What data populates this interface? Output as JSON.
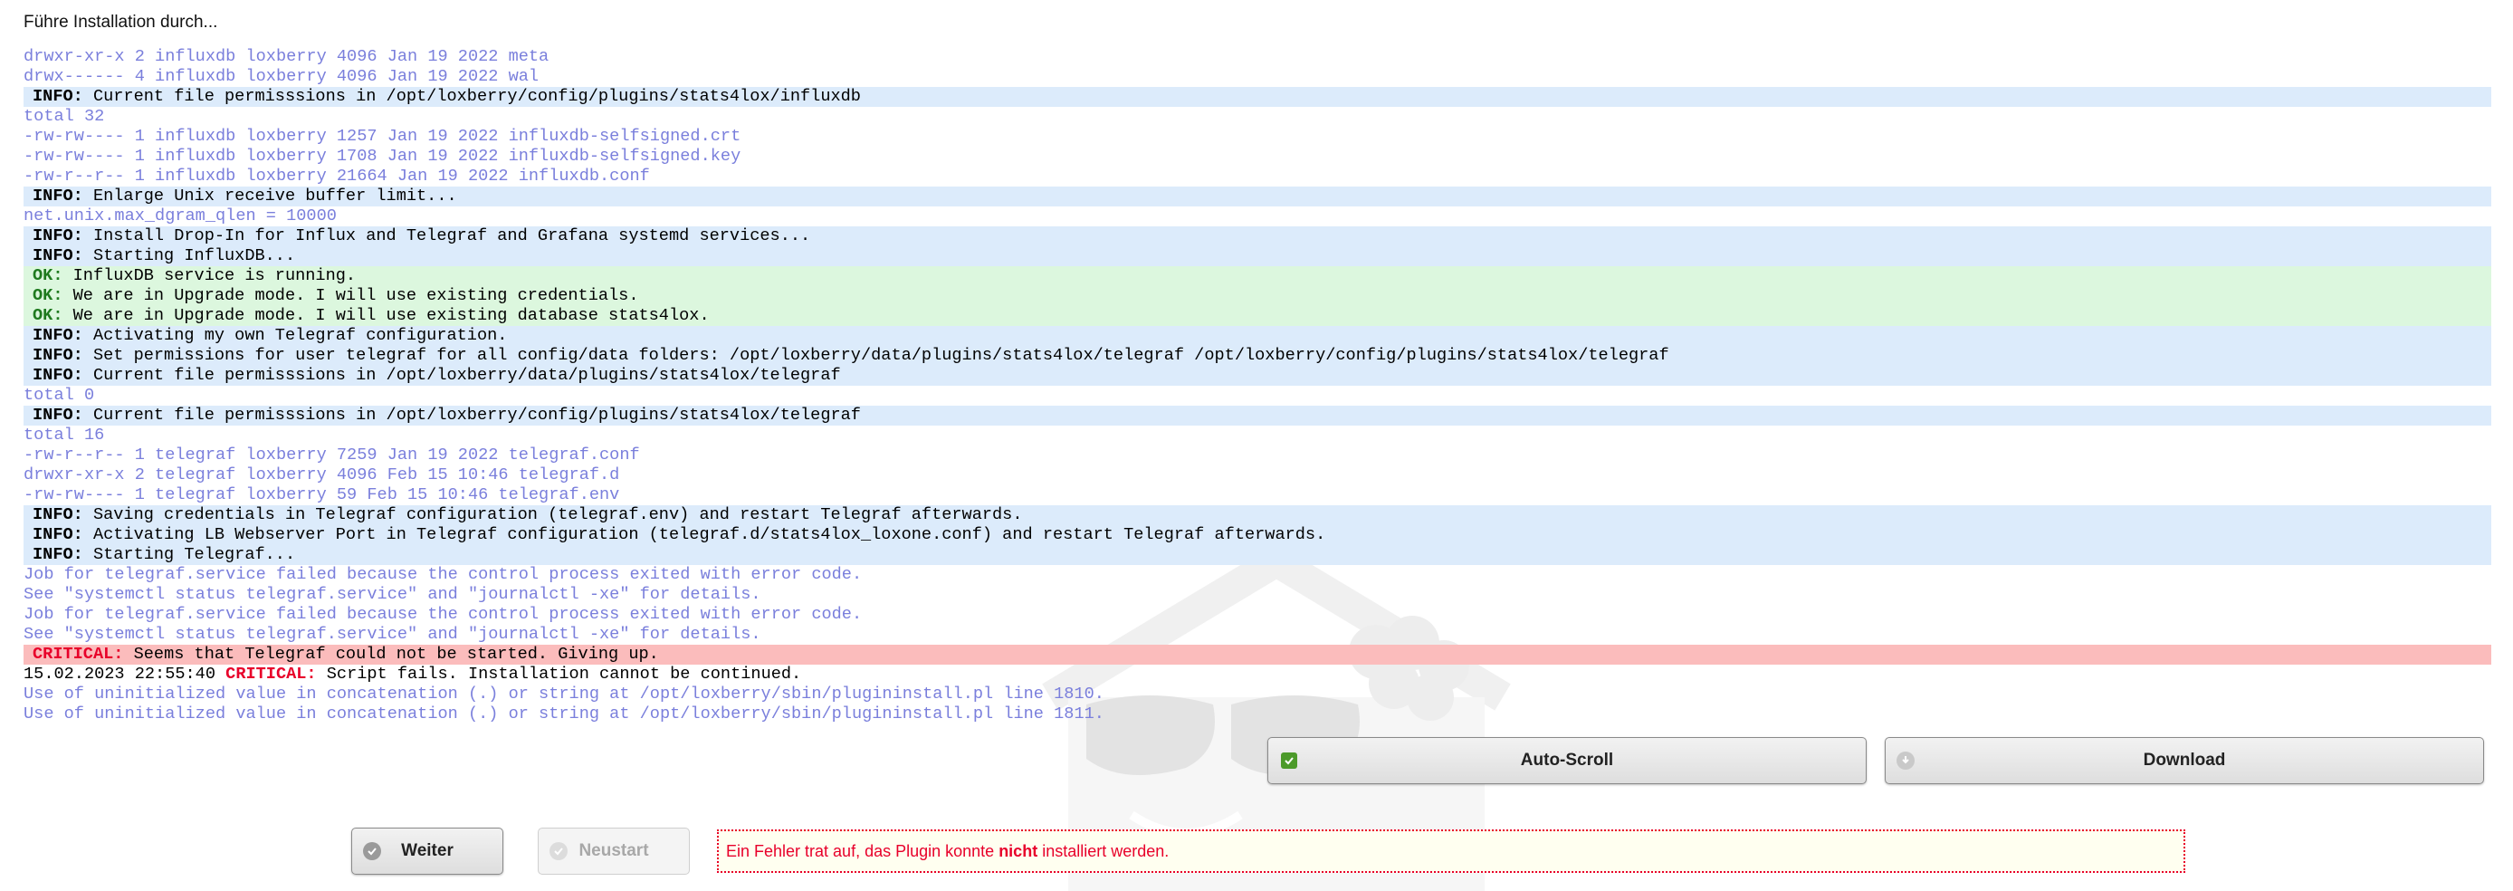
{
  "title": "Führe Installation durch...",
  "log": [
    {
      "type": "plain",
      "text": "drwxr-xr-x 2 influxdb loxberry 4096 Jan 19 2022 meta"
    },
    {
      "type": "plain",
      "text": "drwx------ 4 influxdb loxberry 4096 Jan 19 2022 wal"
    },
    {
      "type": "info",
      "kw": "INFO:",
      "text": " Current file permisssions in /opt/loxberry/config/plugins/stats4lox/influxdb"
    },
    {
      "type": "plain",
      "text": "total 32"
    },
    {
      "type": "plain",
      "text": "-rw-rw---- 1 influxdb loxberry 1257 Jan 19 2022 influxdb-selfsigned.crt"
    },
    {
      "type": "plain",
      "text": "-rw-rw---- 1 influxdb loxberry 1708 Jan 19 2022 influxdb-selfsigned.key"
    },
    {
      "type": "plain",
      "text": "-rw-r--r-- 1 influxdb loxberry 21664 Jan 19 2022 influxdb.conf"
    },
    {
      "type": "info",
      "kw": "INFO:",
      "text": " Enlarge Unix receive buffer limit..."
    },
    {
      "type": "plain",
      "text": "net.unix.max_dgram_qlen = 10000"
    },
    {
      "type": "info",
      "kw": "INFO:",
      "text": " Install Drop-In for Influx and Telegraf and Grafana systemd services..."
    },
    {
      "type": "info",
      "kw": "INFO:",
      "text": " Starting InfluxDB..."
    },
    {
      "type": "ok",
      "kw": "OK:",
      "text": " InfluxDB service is running."
    },
    {
      "type": "ok",
      "kw": "OK:",
      "text": " We are in Upgrade mode. I will use existing credentials."
    },
    {
      "type": "ok",
      "kw": "OK:",
      "text": " We are in Upgrade mode. I will use existing database stats4lox."
    },
    {
      "type": "info",
      "kw": "INFO:",
      "text": " Activating my own Telegraf configuration."
    },
    {
      "type": "info",
      "kw": "INFO:",
      "text": " Set permissions for user telegraf for all config/data folders: /opt/loxberry/data/plugins/stats4lox/telegraf /opt/loxberry/config/plugins/stats4lox/telegraf"
    },
    {
      "type": "info",
      "kw": "INFO:",
      "text": " Current file permisssions in /opt/loxberry/data/plugins/stats4lox/telegraf"
    },
    {
      "type": "plain",
      "text": "total 0"
    },
    {
      "type": "info",
      "kw": "INFO:",
      "text": " Current file permisssions in /opt/loxberry/config/plugins/stats4lox/telegraf"
    },
    {
      "type": "plain",
      "text": "total 16"
    },
    {
      "type": "plain",
      "text": "-rw-r--r-- 1 telegraf loxberry 7259 Jan 19 2022 telegraf.conf"
    },
    {
      "type": "plain",
      "text": "drwxr-xr-x 2 telegraf loxberry 4096 Feb 15 10:46 telegraf.d"
    },
    {
      "type": "plain",
      "text": "-rw-rw---- 1 telegraf loxberry 59 Feb 15 10:46 telegraf.env"
    },
    {
      "type": "info",
      "kw": "INFO:",
      "text": " Saving credentials in Telegraf configuration (telegraf.env) and restart Telegraf afterwards."
    },
    {
      "type": "info",
      "kw": "INFO:",
      "text": " Activating LB Webserver Port in Telegraf configuration (telegraf.d/stats4lox_loxone.conf) and restart Telegraf afterwards."
    },
    {
      "type": "info",
      "kw": "INFO:",
      "text": " Starting Telegraf..."
    },
    {
      "type": "plain",
      "text": "Job for telegraf.service failed because the control process exited with error code."
    },
    {
      "type": "plain",
      "text": "See \"systemctl status telegraf.service\" and \"journalctl -xe\" for details."
    },
    {
      "type": "plain",
      "text": "Job for telegraf.service failed because the control process exited with error code."
    },
    {
      "type": "plain",
      "text": "See \"systemctl status telegraf.service\" and \"journalctl -xe\" for details."
    },
    {
      "type": "crit",
      "kw": "CRITICAL:",
      "text": " Seems that Telegraf could not be started. Giving up."
    },
    {
      "type": "crit-plain",
      "prefix": "15.02.2023 22:55:40 ",
      "kw": "CRITICAL:",
      "text": " Script fails. Installation cannot be continued."
    },
    {
      "type": "plain",
      "text": "Use of uninitialized value in concatenation (.) or string at /opt/loxberry/sbin/plugininstall.pl line 1810."
    },
    {
      "type": "plain",
      "text": "Use of uninitialized value in concatenation (.) or string at /opt/loxberry/sbin/plugininstall.pl line 1811."
    }
  ],
  "buttons": {
    "autoscroll": "Auto-Scroll",
    "download": "Download",
    "weiter": "Weiter",
    "neustart": "Neustart"
  },
  "error": {
    "before": "Ein Fehler trat auf, das Plugin konnte ",
    "bold": "nicht",
    "after": " installiert werden."
  },
  "icons": {
    "autoscroll": "checkbox-checked-icon",
    "download": "download-icon",
    "weiter": "check-circle-icon",
    "neustart": "check-circle-icon"
  },
  "colors": {
    "log_text": "#7a7fdc",
    "info_bg": "#dcebfb",
    "ok_bg": "#dcf7de",
    "critical_bg": "#fbbcbc",
    "critical_text": "#e8002a",
    "ok_text": "#1f7a1f"
  }
}
